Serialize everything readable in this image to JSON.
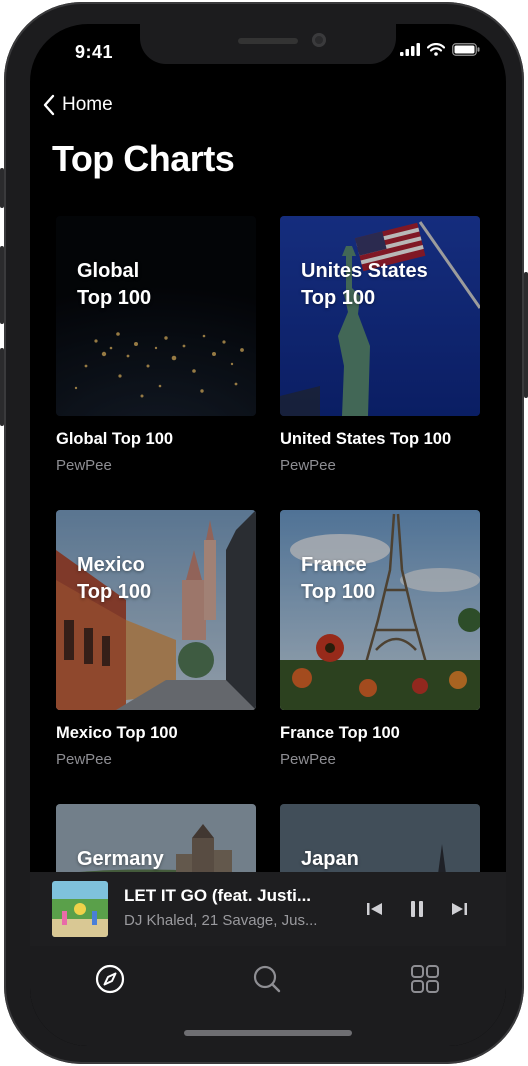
{
  "status_bar": {
    "time": "9:41"
  },
  "nav": {
    "back_label": "Home"
  },
  "page": {
    "title": "Top Charts"
  },
  "charts": [
    {
      "overlay_line1": "Global",
      "overlay_line2": "Top 100",
      "title": "Global Top 100",
      "subtitle": "PewPee"
    },
    {
      "overlay_line1": "Unites States",
      "overlay_line2": "Top 100",
      "title": "United States Top 100",
      "subtitle": "PewPee"
    },
    {
      "overlay_line1": "Mexico",
      "overlay_line2": "Top 100",
      "title": "Mexico Top 100",
      "subtitle": "PewPee"
    },
    {
      "overlay_line1": "France",
      "overlay_line2": "Top 100",
      "title": "France Top 100",
      "subtitle": "PewPee"
    },
    {
      "overlay_line1": "Germany",
      "overlay_line2": "",
      "title": "",
      "subtitle": ""
    },
    {
      "overlay_line1": "Japan",
      "overlay_line2": "",
      "title": "",
      "subtitle": ""
    }
  ],
  "now_playing": {
    "title": "LET IT GO (feat. Justi...",
    "artist": "DJ Khaled, 21 Savage, Jus..."
  },
  "icons": {
    "back": "chevron-left-icon",
    "previous": "skip-previous-icon",
    "pause": "pause-icon",
    "next": "skip-next-icon",
    "explore": "compass-icon",
    "search": "search-icon",
    "library": "grid-icon"
  },
  "colors": {
    "background": "#000000",
    "secondary_text": "#8e8e93",
    "player_bg": "#1e1e20"
  }
}
